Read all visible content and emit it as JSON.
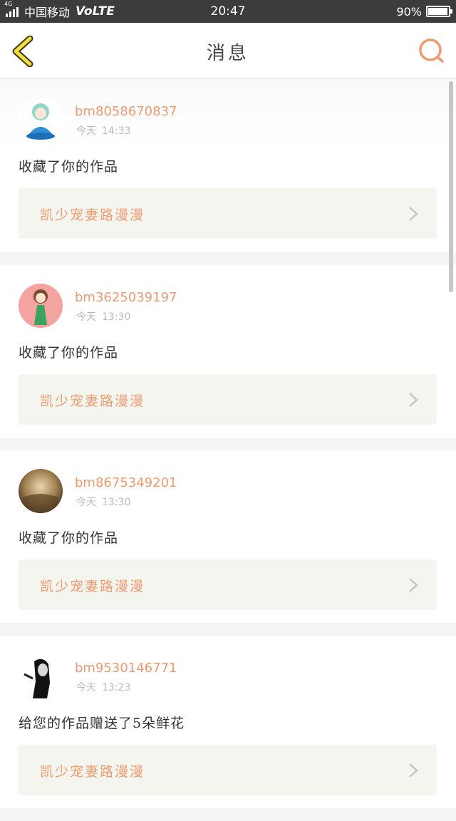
{
  "status_bar": {
    "network_tag": "4G",
    "carrier": "中国移动",
    "volte": "VoLTE",
    "time": "20:47",
    "battery": "90%",
    "battery_level": 0.9
  },
  "header": {
    "title": "消息",
    "back_icon": "chevron-left-icon",
    "search_icon": "search-icon",
    "accent_color": "#ef9a70"
  },
  "messages": [
    {
      "username": "bm8058670837",
      "day": "今天",
      "time": "14:33",
      "text": "收藏了你的作品",
      "work_title": "凯少宠妻路漫漫",
      "avatar_icon": "avatar-anime-blue"
    },
    {
      "username": "bm3625039197",
      "day": "今天",
      "time": "13:30",
      "text": "收藏了你的作品",
      "work_title": "凯少宠妻路漫漫",
      "avatar_icon": "avatar-anime-girl-pink"
    },
    {
      "username": "bm8675349201",
      "day": "今天",
      "time": "13:30",
      "text": "收藏了你的作品",
      "work_title": "凯少宠妻路漫漫",
      "avatar_icon": "avatar-autumn-photo"
    },
    {
      "username": "bm9530146771",
      "day": "今天",
      "time": "13:23",
      "text": "给您的作品赠送了5朵鲜花",
      "work_title": "凯少宠妻路漫漫",
      "avatar_icon": "avatar-bw-portrait"
    }
  ]
}
